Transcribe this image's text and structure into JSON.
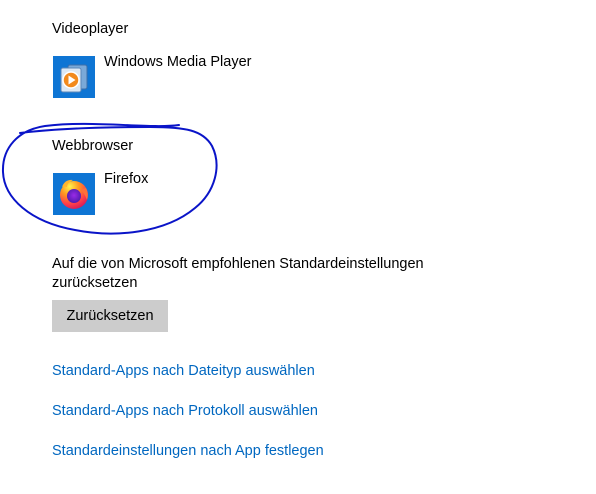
{
  "videoplayer": {
    "label": "Videoplayer",
    "app_name": "Windows Media Player",
    "icon": "windows-media-player-icon"
  },
  "webbrowser": {
    "label": "Webbrowser",
    "app_name": "Firefox",
    "icon": "firefox-icon"
  },
  "reset": {
    "description": "Auf die von Microsoft empfohlenen Standardeinstellungen zurücksetzen",
    "button_label": "Zurücksetzen"
  },
  "links": [
    "Standard-Apps nach Dateityp auswählen",
    "Standard-Apps nach Protokoll auswählen",
    "Standardeinstellungen nach App festlegen"
  ],
  "colors": {
    "link": "#0067c0",
    "tile": "#0e75d4",
    "button": "#cccccc",
    "annotation_ink": "#0a14c8"
  }
}
